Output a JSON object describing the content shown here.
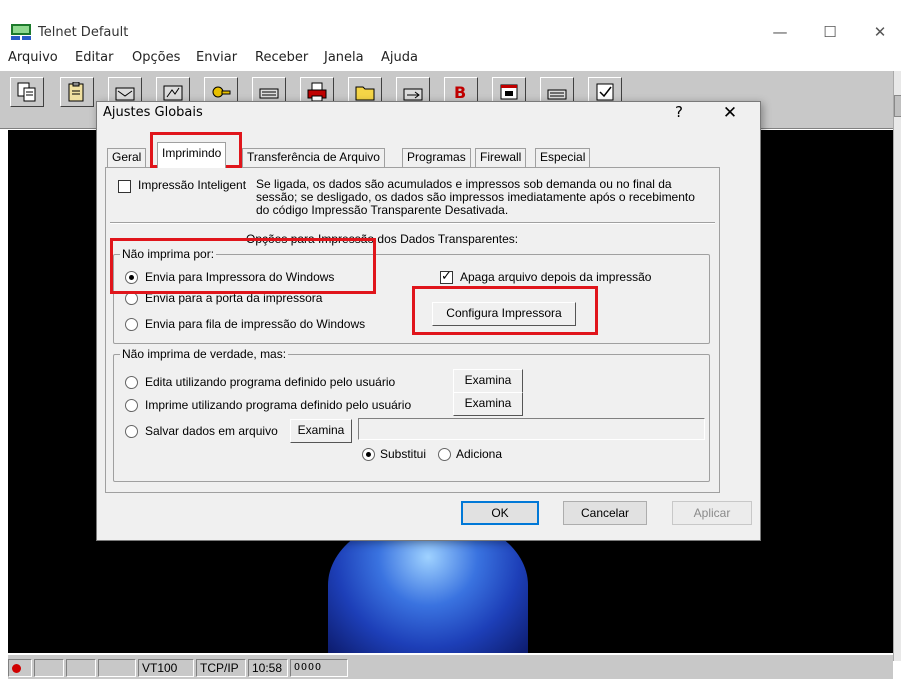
{
  "window": {
    "title": "Telnet Default",
    "controls": {
      "minimize": "—",
      "maximize": "☐",
      "close": "✕"
    }
  },
  "menu": [
    "Arquivo",
    "Editar",
    "Opções",
    "Enviar",
    "Receber",
    "Janela",
    "Ajuda"
  ],
  "toolbar": {
    "buttons": [
      "copy-icon",
      "paste-icon",
      "send-icon",
      "connect-icon",
      "keys-icon",
      "keyboard-icon",
      "printer-icon",
      "folder-icon",
      "transfer-icon",
      "script-icon",
      "window-icon",
      "keyboard-map-icon",
      "check-icon"
    ]
  },
  "statusbar": {
    "emulation": "VT100",
    "protocol": "TCP/IP",
    "time": "10:58",
    "leds": "OOOO"
  },
  "dialog": {
    "title": "Ajustes Globais",
    "help": "?",
    "close": "✕",
    "tabs": [
      "Geral",
      "Imprimindo",
      "Transferência de Arquivo",
      "Programas",
      "Firewall",
      "Especial"
    ],
    "active_tab": "Imprimindo",
    "smart_print": {
      "label": "Impressão Inteligent",
      "checked": false,
      "description": "Se ligada, os dados são acumulados e impressos sob demanda ou no final da sessão; se desligado, os dados são impressos imediatamente após o recebimento do código Impressão Transparente Desativada."
    },
    "transparent_section_title": "Opções para Impressão dos Dados Transparentes:",
    "print_group": {
      "legend": "Não imprima por:",
      "options": [
        {
          "label": "Envia para Impressora do Windows",
          "checked": true
        },
        {
          "label": "Envia para a porta da impressora",
          "checked": false
        },
        {
          "label": "Envia para fila de impressão do Windows",
          "checked": false
        }
      ],
      "delete_after": {
        "label": "Apaga arquivo depois da impressão",
        "checked": true
      },
      "configure_button": "Configura Impressora"
    },
    "no_print_group": {
      "legend": "Não imprima de verdade, mas:",
      "options": [
        {
          "label": "Edita utilizando programa definido pelo usuário",
          "button": "Examina",
          "checked": false
        },
        {
          "label": "Imprime utilizando programa definido pelo usuário",
          "button": "Examina",
          "checked": false
        },
        {
          "label": "Salvar dados em arquivo",
          "button": "Examina",
          "checked": false
        }
      ],
      "file_path": "",
      "mode_options": [
        {
          "label": "Substitui",
          "checked": true
        },
        {
          "label": "Adiciona",
          "checked": false
        }
      ]
    },
    "buttons": {
      "ok": "OK",
      "cancel": "Cancelar",
      "apply": "Aplicar"
    }
  },
  "colors": {
    "highlight": "#e0151b",
    "terminal_bg": "#000000",
    "dialog_bg": "#f0f0f0",
    "status_led": "#d00000"
  }
}
